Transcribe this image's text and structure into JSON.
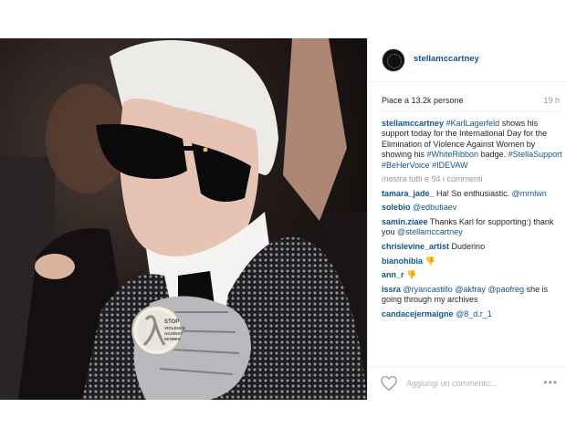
{
  "header": {
    "username": "stellamccartney"
  },
  "photo": {
    "alt_subject": "",
    "badge_text": [
      "STOP",
      "VIOLENCE",
      "AGAINST",
      "WOMEN"
    ]
  },
  "likes": {
    "text": "Piace a 13.2k persone",
    "time": "19 h"
  },
  "caption": {
    "user": "stellamccartney",
    "parts": [
      {
        "t": "tag",
        "v": "#KarlLagerfeld"
      },
      {
        "t": "txt",
        "v": " shows his support today for the International Day for the Elimination of Violence Against Women by showing his "
      },
      {
        "t": "tag",
        "v": "#WhiteRibbon"
      },
      {
        "t": "txt",
        "v": " badge. "
      },
      {
        "t": "tag",
        "v": "#StellaSupport"
      },
      {
        "t": "txt",
        "v": " "
      },
      {
        "t": "tag",
        "v": "#BeHerVoice"
      },
      {
        "t": "txt",
        "v": " "
      },
      {
        "t": "tag",
        "v": "#IDEVAW"
      }
    ]
  },
  "more_comments": "mostra tutti e 94 i commenti",
  "comments": [
    {
      "user": "tamara_jade_",
      "parts": [
        {
          "t": "txt",
          "v": " Ha! So enthusiastic. "
        },
        {
          "t": "tag",
          "v": "@mrnlwn"
        }
      ]
    },
    {
      "user": "solebio",
      "parts": [
        {
          "t": "txt",
          "v": " "
        },
        {
          "t": "tag",
          "v": "@edbutiaev"
        }
      ]
    },
    {
      "user": "samin.ziaee",
      "parts": [
        {
          "t": "txt",
          "v": " Thanks Karl for supporting:) thank you "
        },
        {
          "t": "tag",
          "v": "@stellamccartney"
        }
      ]
    },
    {
      "user": "chrislevine_artist",
      "parts": [
        {
          "t": "txt",
          "v": " Duderino"
        }
      ]
    },
    {
      "user": "bianohibia",
      "parts": [
        {
          "t": "txt",
          "v": " 👎"
        }
      ]
    },
    {
      "user": "ann_r",
      "parts": [
        {
          "t": "txt",
          "v": " 👎"
        }
      ]
    },
    {
      "user": "issra",
      "parts": [
        {
          "t": "txt",
          "v": " "
        },
        {
          "t": "tag",
          "v": "@ryancastillo"
        },
        {
          "t": "txt",
          "v": " "
        },
        {
          "t": "tag",
          "v": "@akfray"
        },
        {
          "t": "txt",
          "v": " "
        },
        {
          "t": "tag",
          "v": "@paofreg"
        },
        {
          "t": "txt",
          "v": " she is going through my archives"
        }
      ]
    },
    {
      "user": "candacejermaigne",
      "parts": [
        {
          "t": "txt",
          "v": " "
        },
        {
          "t": "tag",
          "v": "@8_d.r_1"
        }
      ]
    }
  ],
  "add_comment": {
    "placeholder": "Aggiungi un commento...",
    "more_icon": "more-options-icon",
    "like_icon": "heart-icon"
  },
  "colors": {
    "link": "#125688",
    "muted": "#999999",
    "border": "#efefef"
  }
}
